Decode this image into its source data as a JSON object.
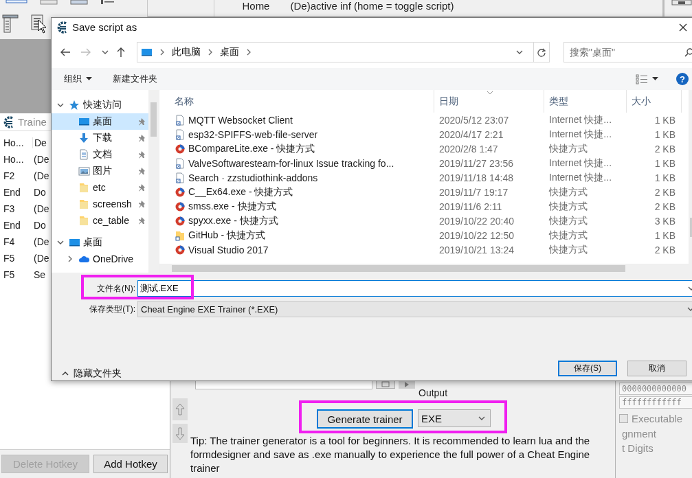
{
  "background_window": {
    "hotkey": "Home",
    "description": "(De)active inf (home = toggle script)"
  },
  "trainer_window": {
    "title": "Traine",
    "columns": [
      "Ho...",
      "De"
    ],
    "rows": [
      {
        "hotkey": "Ho...",
        "description": "(De"
      },
      {
        "hotkey": "F2",
        "description": "(De"
      },
      {
        "hotkey": "End",
        "description": "Do"
      },
      {
        "hotkey": "F3",
        "description": "(De"
      },
      {
        "hotkey": "End",
        "description": "Do"
      },
      {
        "hotkey": "F4",
        "description": "(De"
      },
      {
        "hotkey": "F5",
        "description": "(De"
      },
      {
        "hotkey": "F5",
        "description": "Se"
      }
    ],
    "buttons": [
      {
        "label": "Delete Hotkey",
        "disabled": true
      },
      {
        "label": "Add Hotkey",
        "disabled": false
      }
    ]
  },
  "generator_panel": {
    "output_label": "Output",
    "generate_button": {
      "label": "Generate trainer",
      "focused": true
    },
    "output_select": "EXE",
    "tip": "Tip: The trainer generator is a tool for beginners. It is recommended to learn lua and the formdesigner and save as .exe manually to experience the full power of a Cheat Engine trainer"
  },
  "side_panel": {
    "fields": [
      "0000000000000",
      "ffffffffffff"
    ],
    "executable": {
      "label": "Executable",
      "checked": false,
      "disabled": true
    },
    "labels": [
      "gnment",
      "t Digits"
    ]
  },
  "dialog": {
    "title": "Save script as",
    "breadcrumbs": [
      "此电脑",
      "桌面"
    ],
    "search": {
      "placeholder": "搜索\"桌面\""
    },
    "toolbar": {
      "organize": "组织",
      "new_folder": "新建文件夹",
      "help": "?"
    },
    "nav_tree": [
      {
        "label": "快速访问",
        "kind": "star",
        "expanded": true,
        "selected": false,
        "children": [
          {
            "label": "桌面",
            "kind": "desktop",
            "selected": true,
            "pinned": true
          },
          {
            "label": "下载",
            "kind": "download",
            "selected": false,
            "pinned": true
          },
          {
            "label": "文档",
            "kind": "document",
            "selected": false,
            "pinned": true
          },
          {
            "label": "图片",
            "kind": "picture",
            "selected": false,
            "pinned": true
          },
          {
            "label": "etc",
            "kind": "folder",
            "selected": false,
            "pinned": true
          },
          {
            "label": "screensh",
            "kind": "folder",
            "selected": false,
            "pinned": true
          },
          {
            "label": "ce_table",
            "kind": "folder",
            "selected": false,
            "pinned": true
          }
        ]
      },
      {
        "label": "桌面",
        "kind": "desktop",
        "expanded": true,
        "selected": false,
        "children": [
          {
            "label": "OneDrive",
            "kind": "cloud",
            "expanded": false,
            "selected": false,
            "pinned": false
          }
        ]
      }
    ],
    "columns": [
      "名称",
      "日期",
      "类型",
      "大小"
    ],
    "files": [
      {
        "name": "MQTT Websocket Client",
        "date": "2020/5/12 23:07",
        "type": "Internet 快捷...",
        "size": "1 KB",
        "kind": "url"
      },
      {
        "name": "esp32-SPIFFS-web-file-server",
        "date": "2020/4/17 2:21",
        "type": "Internet 快捷...",
        "size": "1 KB",
        "kind": "url"
      },
      {
        "name": "BCompareLite.exe - 快捷方式",
        "date": "2020/2/8 1:47",
        "type": "快捷方式",
        "size": "2 KB",
        "kind": "app"
      },
      {
        "name": "ValveSoftwaresteam-for-linux Issue tracking fo...",
        "date": "2019/11/27 23:56",
        "type": "Internet 快捷...",
        "size": "1 KB",
        "kind": "url"
      },
      {
        "name": "Search · zzstudiothink-addons",
        "date": "2019/11/18 14:48",
        "type": "Internet 快捷...",
        "size": "1 KB",
        "kind": "url"
      },
      {
        "name": "C__Ex64.exe - 快捷方式",
        "date": "2019/11/7 19:17",
        "type": "快捷方式",
        "size": "2 KB",
        "kind": "app"
      },
      {
        "name": "smss.exe - 快捷方式",
        "date": "2019/11/6 2:11",
        "type": "快捷方式",
        "size": "2 KB",
        "kind": "app"
      },
      {
        "name": "spyxx.exe - 快捷方式",
        "date": "2019/10/22 20:40",
        "type": "快捷方式",
        "size": "3 KB",
        "kind": "app"
      },
      {
        "name": "GitHub - 快捷方式",
        "date": "2019/10/22 12:50",
        "type": "快捷方式",
        "size": "1 KB",
        "kind": "folder"
      },
      {
        "name": "Visual Studio 2017",
        "date": "2019/10/21 13:24",
        "type": "快捷方式",
        "size": "2 KB",
        "kind": "app"
      }
    ],
    "file_name": {
      "label": "文件名(N):",
      "value": "测试.EXE"
    },
    "file_type": {
      "label": "保存类型(T):",
      "value": "Cheat Engine EXE Trainer (*.EXE)"
    },
    "hide_folders": "隐藏文件夹",
    "buttons": [
      {
        "label": "保存(S)",
        "default": true
      },
      {
        "label": "取消",
        "default": false
      }
    ]
  }
}
